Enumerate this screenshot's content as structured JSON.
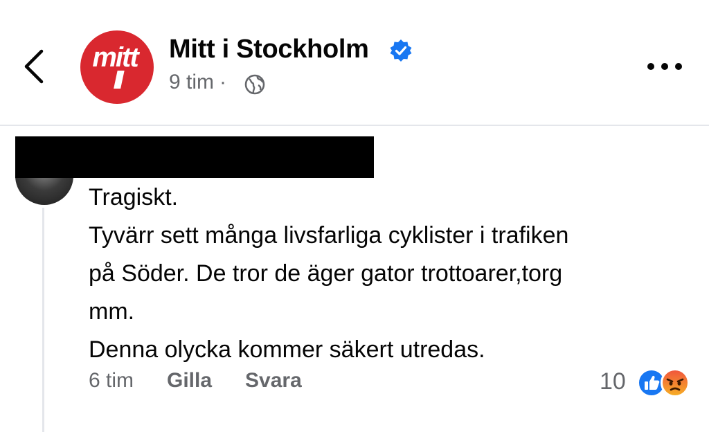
{
  "header": {
    "page_name": "Mitt i Stockholm",
    "logo_text": "mitt i",
    "time": "9 tim",
    "separator": "·",
    "brand_color": "#d9282f",
    "verified_color": "#1877f2"
  },
  "comment": {
    "lines": [
      "Tragiskt.",
      "Tyvärr sett många livsfarliga cyklister i trafiken",
      "på Söder. De tror de äger gator trottoarer,torg",
      "mm.",
      "Denna olycka kommer säkert utredas."
    ],
    "time": "6 tim",
    "like_label": "Gilla",
    "reply_label": "Svara",
    "reaction_count": "10",
    "reactions": [
      "like-icon",
      "angry-icon"
    ]
  }
}
